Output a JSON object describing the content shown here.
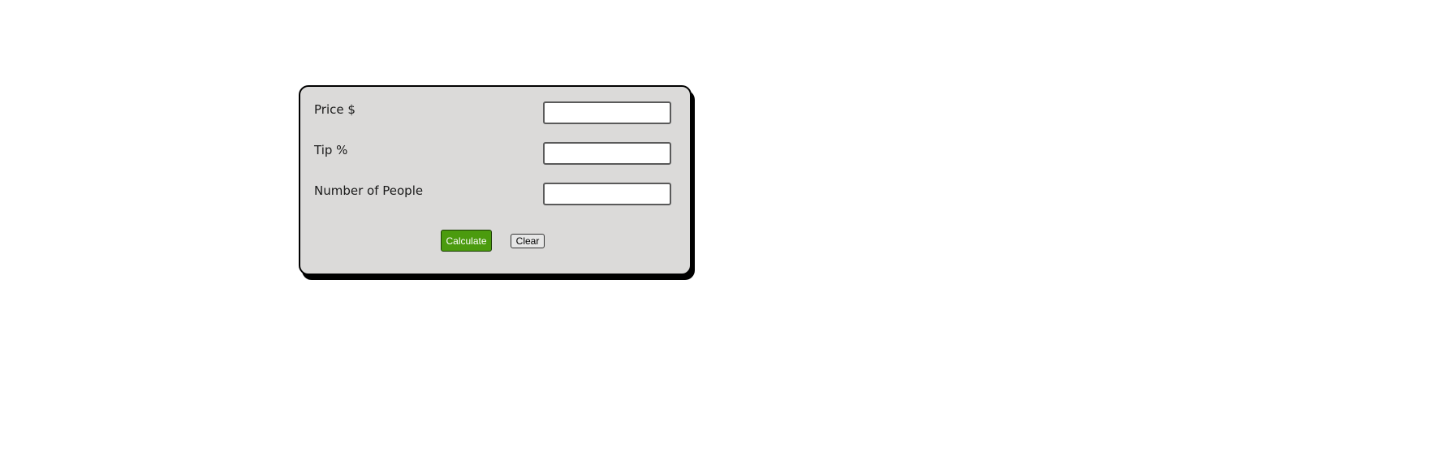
{
  "form": {
    "fields": [
      {
        "label": "Price $",
        "value": ""
      },
      {
        "label": "Tip %",
        "value": ""
      },
      {
        "label": "Number of People",
        "value": ""
      }
    ],
    "calculate_label": "Calculate",
    "clear_label": "Clear"
  },
  "colors": {
    "panel_background": "#dbdad9",
    "calculate_button": "#4b9b0e"
  }
}
